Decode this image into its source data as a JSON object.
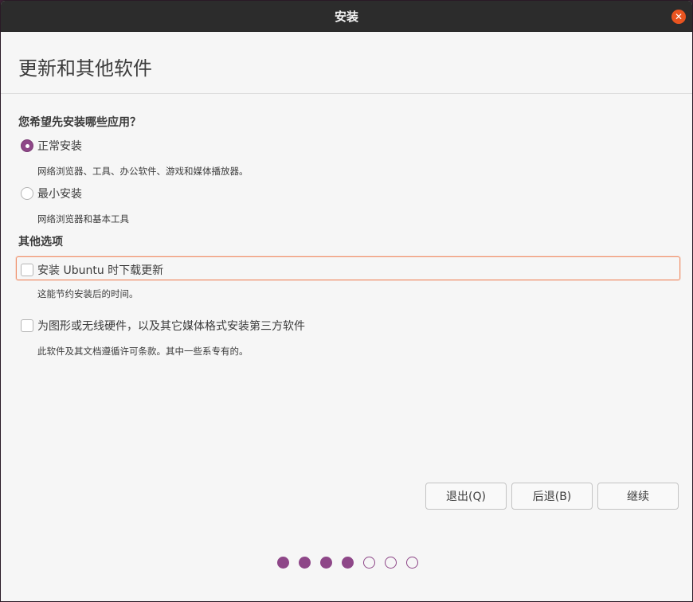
{
  "window": {
    "title": "安装"
  },
  "page": {
    "title": "更新和其他软件"
  },
  "install_type": {
    "heading": "您希望先安装哪些应用？",
    "normal": {
      "label": "正常安装",
      "description": "网络浏览器、工具、办公软件、游戏和媒体播放器。",
      "selected": true
    },
    "minimal": {
      "label": "最小安装",
      "description": "网络浏览器和基本工具",
      "selected": false
    }
  },
  "other_options": {
    "heading": "其他选项",
    "download_updates": {
      "label": "安装 Ubuntu 时下载更新",
      "description": "这能节约安装后的时间。",
      "checked": false
    },
    "third_party": {
      "label": "为图形或无线硬件，以及其它媒体格式安装第三方软件",
      "description": "此软件及其文档遵循许可条款。其中一些系专有的。",
      "checked": false
    }
  },
  "buttons": {
    "quit": "退出(Q)",
    "back": "后退(B)",
    "continue": "继续"
  },
  "progress": {
    "total_steps": 7,
    "completed_steps": 4
  },
  "colors": {
    "accent": "#8e4788",
    "close": "#e95420",
    "focus": "#f08e67"
  }
}
